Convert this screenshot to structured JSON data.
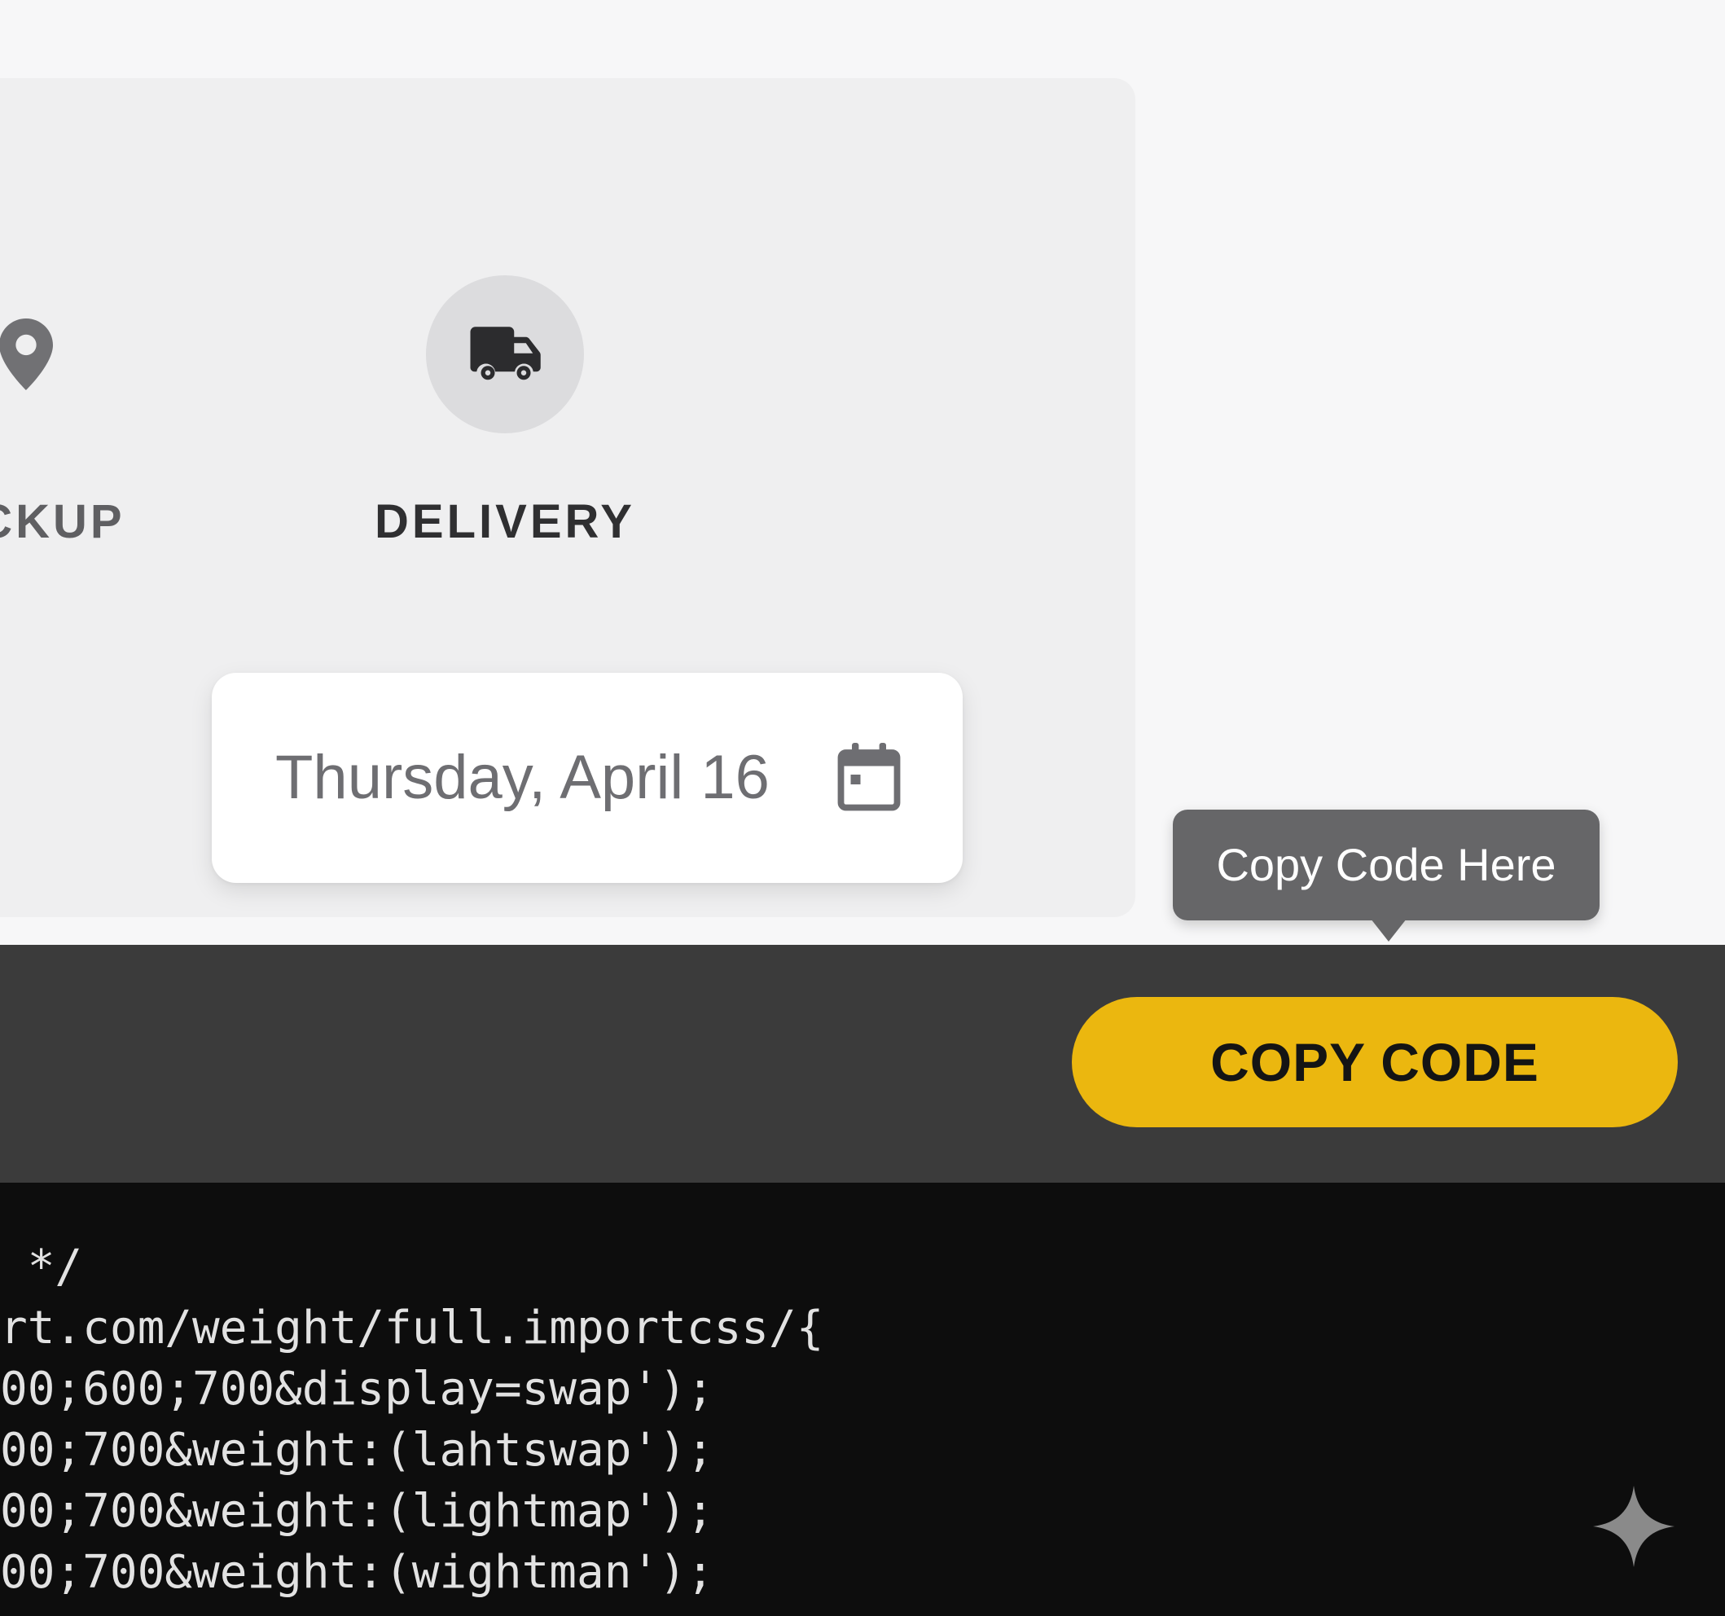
{
  "options": {
    "pickup": {
      "label": "PICKUP",
      "icon": "location-pin-icon"
    },
    "delivery": {
      "label": "DELIVERY",
      "icon": "delivery-truck-icon",
      "selected": true
    }
  },
  "date_field": {
    "value": "Thursday, April 16",
    "icon": "calendar-icon"
  },
  "tooltip": {
    "text": "Copy Code Here"
  },
  "toolbar": {
    "copy_button_label": "COPY CODE"
  },
  "code": {
    "lines": [
      " */",
      "rt.com/weight/full.importcss/{",
      "00;600;700&display=swap');",
      "00;700&weight:(lahtswap');",
      "00;700&weight:(lightmap');",
      "00;700&weight:(wightman');"
    ]
  },
  "colors": {
    "accent": "#ebb70f",
    "toolbar_bg": "#3b3b3b",
    "code_bg": "#0d0d0d",
    "tooltip_bg": "#666668"
  }
}
